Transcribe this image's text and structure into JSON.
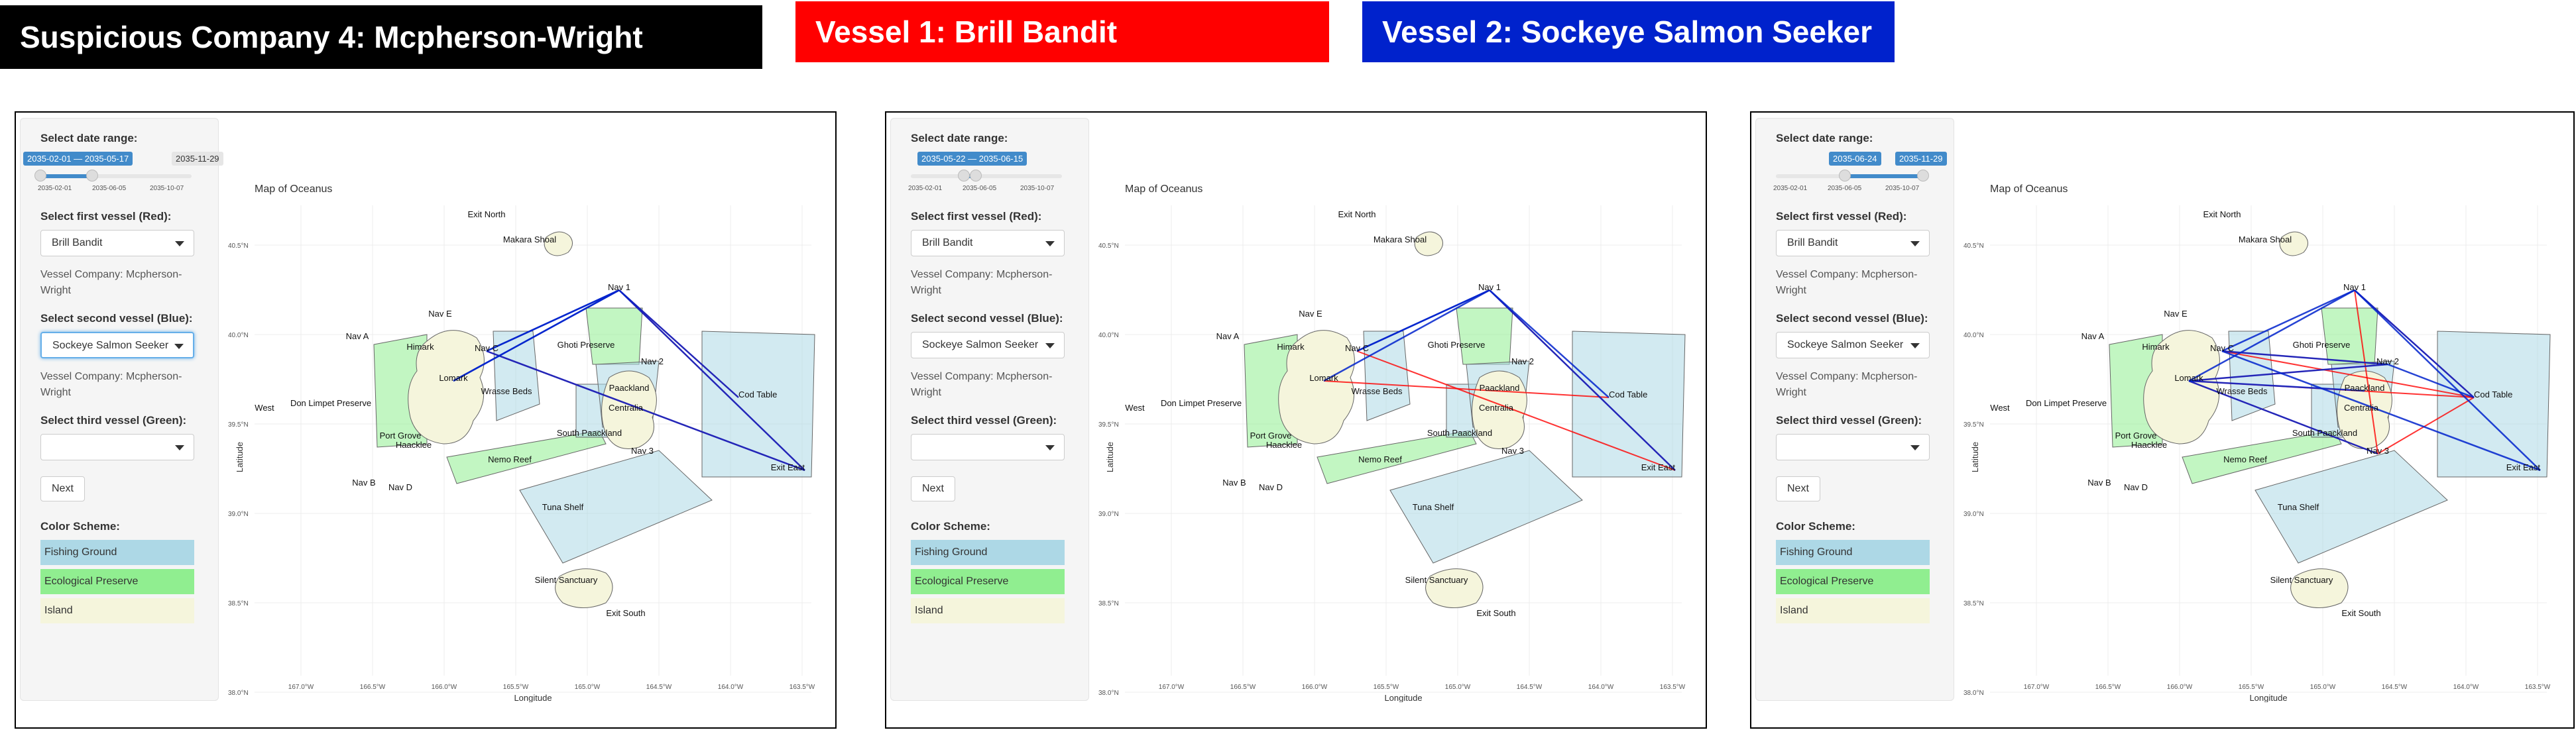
{
  "banners": {
    "company": "Suspicious Company 4: Mcpherson-Wright",
    "vessel1": "Vessel 1: Brill Bandit",
    "vessel2": "Vessel 2: Sockeye Salmon Seeker"
  },
  "colors": {
    "company": "#000000",
    "vessel1": "#ff0000",
    "vessel2": "#0022cc",
    "fishing": "#add8e6",
    "preserve": "#90ee90",
    "island": "#f5f5dc"
  },
  "sidebar_labels": {
    "date_range": "Select date range:",
    "first_vessel": "Select first vessel (Red):",
    "second_vessel": "Select second vessel (Blue):",
    "third_vessel": "Select third vessel (Green):",
    "company_info": "Vessel Company: Mcpherson-Wright",
    "next": "Next",
    "color_scheme": "Color Scheme:",
    "fishing": "Fishing Ground",
    "preserve": "Ecological Preserve",
    "island": "Island"
  },
  "slider_ticks": [
    "2035-02-01",
    "2035-06-05",
    "2035-10-07"
  ],
  "panels": [
    {
      "date_badge": "2035-02-01 — 2035-05-17",
      "max_badge": "2035-11-29",
      "first_vessel": "Brill Bandit",
      "second_vessel": "Sockeye Salmon Seeker",
      "third_vessel": "",
      "range_start": 0.0,
      "range_end": 0.35
    },
    {
      "date_badge": "2035-05-22 — 2035-06-15",
      "max_badge": "",
      "first_vessel": "Brill Bandit",
      "second_vessel": "Sockeye Salmon Seeker",
      "third_vessel": "",
      "range_start": 0.36,
      "range_end": 0.44
    },
    {
      "date_badge": "2035-06-24",
      "max_badge": "2035-11-29",
      "first_vessel": "Brill Bandit",
      "second_vessel": "Sockeye Salmon Seeker",
      "third_vessel": "",
      "range_start": 0.47,
      "range_end": 1.0
    }
  ],
  "map": {
    "title": "Map of Oceanus",
    "xlabel": "Longitude",
    "ylabel": "Latitude",
    "x_ticks": [
      "167.0°W",
      "166.5°W",
      "166.0°W",
      "165.5°W",
      "165.0°W",
      "164.5°W",
      "164.0°W",
      "163.5°W"
    ],
    "y_ticks": [
      "40.5°N",
      "40.0°N",
      "39.5°N",
      "39.0°N",
      "38.5°N",
      "38.0°N"
    ],
    "places": [
      "Exit North",
      "Makara Shoal",
      "Nav E",
      "Nav A",
      "Himark",
      "Nav C",
      "Nav 1",
      "Ghoti Preserve",
      "Nav 2",
      "Lomark",
      "Wrasse Beds",
      "Paackland",
      "Centralia",
      "Cod Table",
      "West",
      "Don Limpet Preserve",
      "Port Grove",
      "Haacklee",
      "South Paackland",
      "Nav 3",
      "Nemo Reef",
      "Exit East",
      "Nav B",
      "Nav D",
      "Tuna Shelf",
      "Silent Sanctuary",
      "Exit South"
    ]
  }
}
